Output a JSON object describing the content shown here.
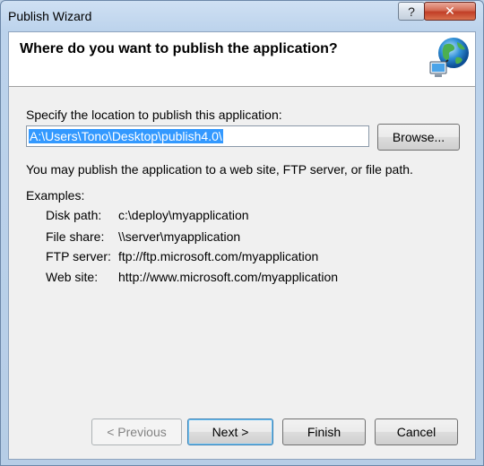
{
  "window": {
    "title": "Publish Wizard",
    "help_glyph": "?",
    "close_glyph": "✕"
  },
  "header": {
    "title": "Where do you want to publish the application?",
    "icon": "globe-network-icon"
  },
  "location": {
    "prompt": "Specify the location to publish this application:",
    "value": "A:\\Users\\Tono\\Desktop\\publish4.0\\",
    "browse_label": "Browse..."
  },
  "info": "You may publish the application to a web site, FTP server, or file path.",
  "examples": {
    "heading": "Examples:",
    "items": [
      {
        "label": "Disk path:",
        "value": "c:\\deploy\\myapplication"
      },
      {
        "label": "File share:",
        "value": "\\\\server\\myapplication"
      },
      {
        "label": "FTP server:",
        "value": "ftp://ftp.microsoft.com/myapplication"
      },
      {
        "label": "Web site:",
        "value": "http://www.microsoft.com/myapplication"
      }
    ]
  },
  "buttons": {
    "previous": "< Previous",
    "next": "Next >",
    "finish": "Finish",
    "cancel": "Cancel"
  },
  "colors": {
    "selection": "#3399ff",
    "close_button": "#c13e26",
    "frame": "#bcd3ec"
  }
}
